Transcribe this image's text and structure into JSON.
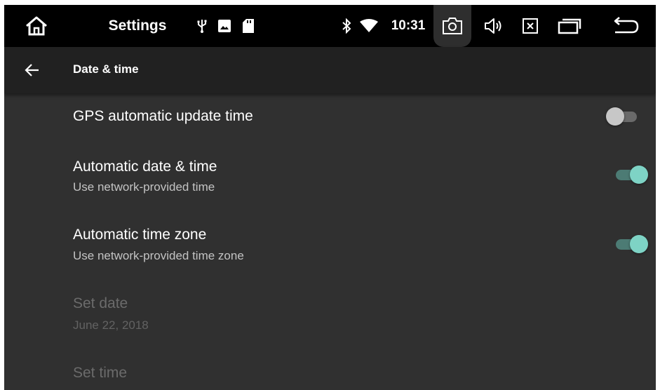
{
  "statusbar": {
    "title": "Settings",
    "time": "10:31",
    "icons": [
      "home-icon",
      "usb-icon",
      "image-icon",
      "sd-card-icon",
      "bluetooth-icon",
      "wifi-icon",
      "camera-icon",
      "volume-icon",
      "close-app-icon",
      "recent-apps-icon",
      "back-icon"
    ]
  },
  "actionbar": {
    "title": "Date & time",
    "back_icon": "arrow-left-icon"
  },
  "settings": {
    "gps_update": {
      "title": "GPS automatic update time",
      "enabled": false
    },
    "auto_datetime": {
      "title": "Automatic date & time",
      "subtitle": "Use network-provided time",
      "enabled": true
    },
    "auto_timezone": {
      "title": "Automatic time zone",
      "subtitle": "Use network-provided time zone",
      "enabled": true
    },
    "set_date": {
      "title": "Set date",
      "subtitle": "June 22, 2018"
    },
    "set_time": {
      "title": "Set time"
    }
  },
  "colors": {
    "accent": "#7ed3c5",
    "background": "#303030",
    "actionbar": "#212121"
  }
}
